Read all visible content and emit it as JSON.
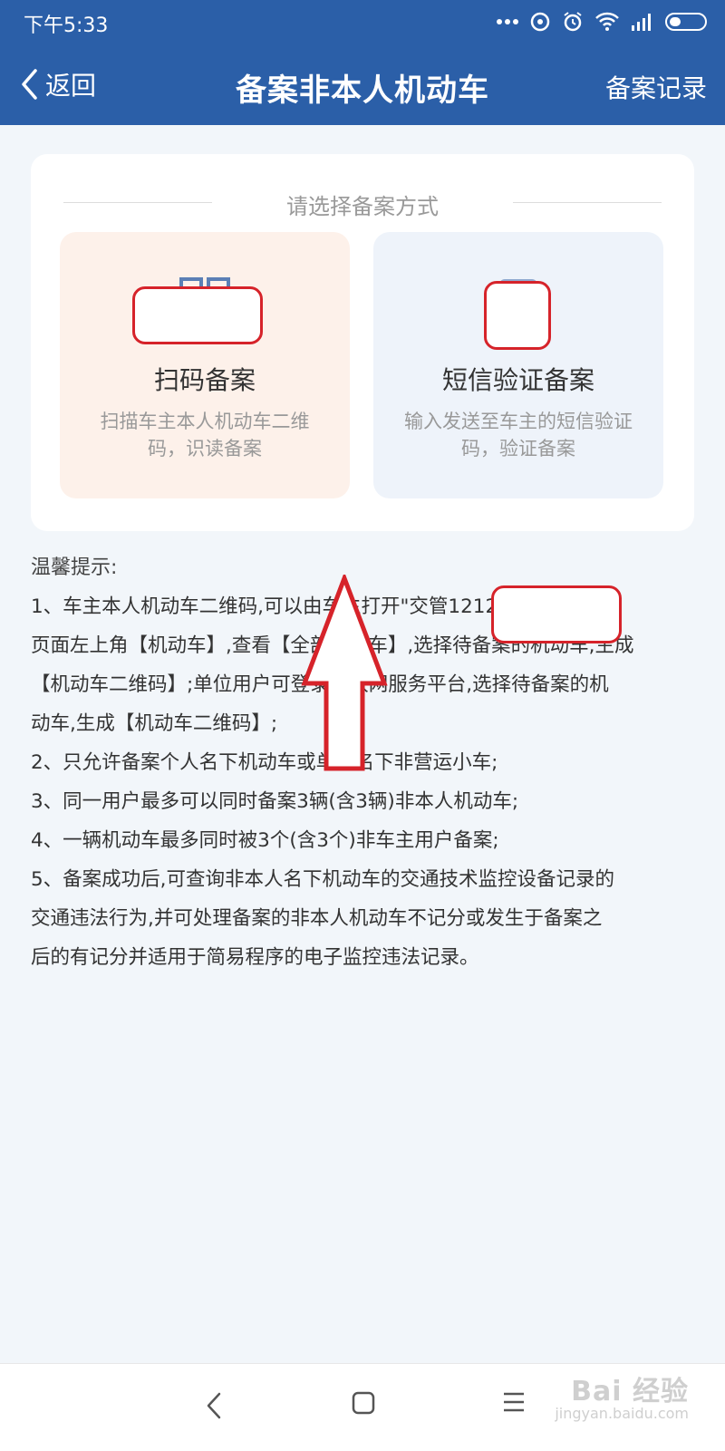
{
  "status_bar": {
    "time": "下午5:33",
    "icons": [
      "more-dots-icon",
      "hotspot-icon",
      "alarm-icon",
      "wifi-icon",
      "signal-icon",
      "battery-icon"
    ]
  },
  "header": {
    "back_label": "返回",
    "title": "备案非本人机动车",
    "record_label": "备案记录"
  },
  "method_card": {
    "title": "请选择备案方式",
    "options": [
      {
        "label": "扫码备案",
        "desc_line1": "扫描车主本人机动车二维",
        "desc_line2": "码，识读备案",
        "icon": "qrcode-icon",
        "bg_color": "#fdf1ea"
      },
      {
        "label": "短信验证备案",
        "desc_line1": "输入发送至车主的短信验证",
        "desc_line2": "码，验证备案",
        "icon": "phone-sms-icon",
        "bg_color": "#eef3fa"
      }
    ]
  },
  "tips": {
    "title": "温馨提示:",
    "lines": [
      "1、车主本人机动车二维码,可以由车主打开\"交管12123\"APP,点击首",
      "页面左上角【机动车】,查看【全部机动车】,选择待备案的机动车,生成",
      "【机动车二维码】;单位用户可登录互联网服务平台,选择待备案的机",
      "动车,生成【机动车二维码】;",
      "2、只允许备案个人名下机动车或单位名下非营运小车;",
      "3、同一用户最多可以同时备案3辆(含3辆)非本人机动车;",
      "4、一辆机动车最多同时被3个(含3个)非车主用户备案;",
      "5、备案成功后,可查询非本人名下机动车的交通技术监控设备记录的",
      "交通违法行为,并可处理备案的非本人机动车不记分或发生于备案之",
      "后的有记分并适用于简易程序的电子监控违法记录。"
    ]
  },
  "watermark": {
    "main": "Bai 经验",
    "sub": "jingyan.baidu.com"
  },
  "colors": {
    "header_bg": "#2b5fa8",
    "page_bg": "#f2f6fa",
    "annotation_red": "#d6232a"
  }
}
